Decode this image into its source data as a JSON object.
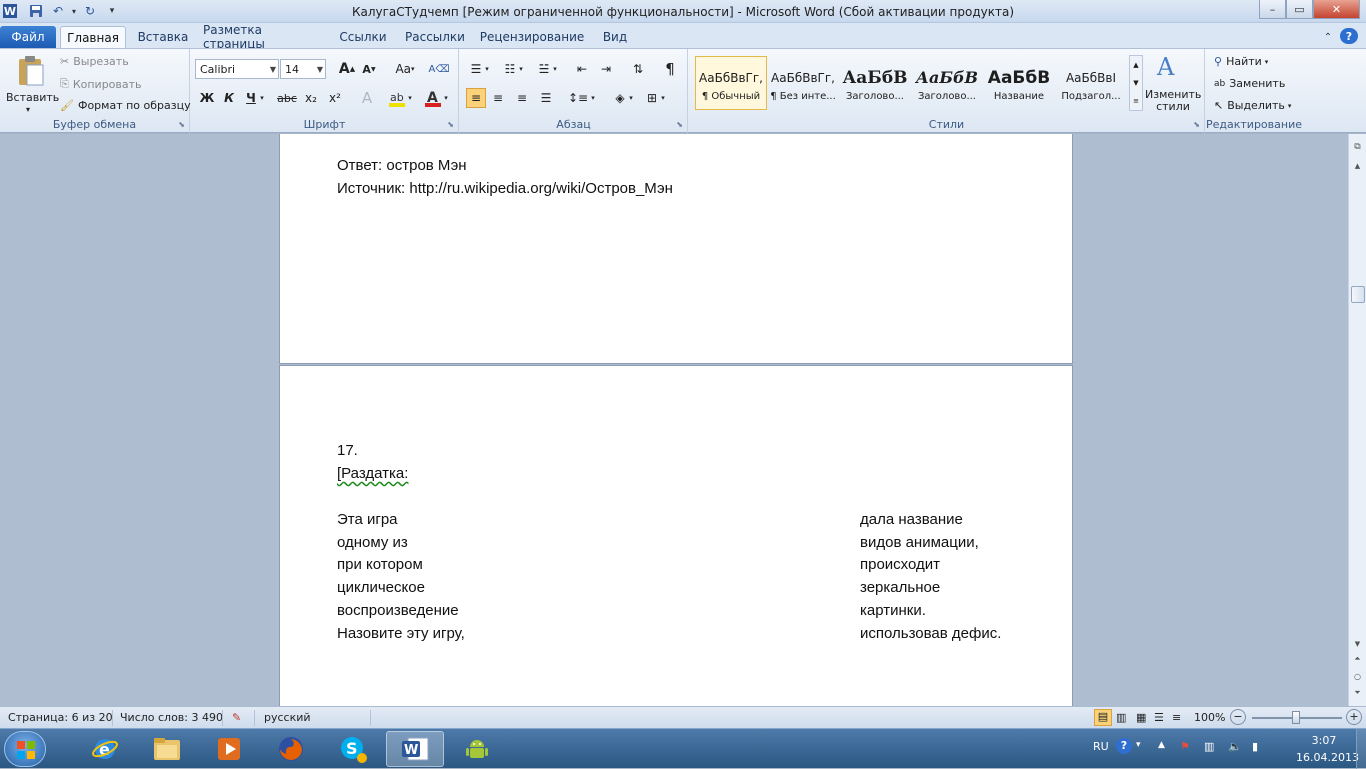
{
  "window": {
    "title": "КалугаСТудчемп [Режим ограниченной функциональности]  -  Microsoft Word (Сбой активации продукта)",
    "app_icon": "W",
    "minimize_glyph": "–",
    "maximize_glyph": "▭",
    "close_glyph": "✕"
  },
  "tabs": {
    "file": "Файл",
    "home": "Главная",
    "insert": "Вставка",
    "layout": "Разметка страницы",
    "references": "Ссылки",
    "mailings": "Рассылки",
    "review": "Рецензирование",
    "view": "Вид"
  },
  "clipboard": {
    "paste": "Вставить",
    "cut": "Вырезать",
    "copy": "Копировать",
    "format_painter": "Формат по образцу",
    "label": "Буфер обмена"
  },
  "font": {
    "name": "Calibri",
    "size": "14",
    "label": "Шрифт",
    "bold": "Ж",
    "italic": "К",
    "underline": "Ч",
    "strike": "abc",
    "subscript": "x₂",
    "superscript": "x²",
    "grow": "A",
    "shrink": "A",
    "change_case": "Aa",
    "font_color": "A",
    "font_color_hex": "#d7211f",
    "highlight_hex": "#f0e000"
  },
  "paragraph": {
    "label": "Абзац",
    "pilcrow": "¶"
  },
  "styles": {
    "label": "Стили",
    "items": [
      {
        "preview": "АаБбВвГг,",
        "name": "¶ Обычный"
      },
      {
        "preview": "АаБбВвГг,",
        "name": "¶ Без инте..."
      },
      {
        "preview": "АаБбВ",
        "name": "Заголово..."
      },
      {
        "preview": "АаБбВ",
        "name": "Заголово..."
      },
      {
        "preview": "АаБбВ",
        "name": "Название"
      },
      {
        "preview": "АаБбВвІ",
        "name": "Подзагол..."
      }
    ],
    "change_styles": "Изменить стили"
  },
  "editing": {
    "label": "Редактирование",
    "find": "Найти",
    "replace": "Заменить",
    "select": "Выделить"
  },
  "document": {
    "page1_lines": [
      "Ответ: остров Мэн",
      "Источник: http://ru.wikipedia.org/wiki/Остров_Мэн"
    ],
    "number": "17.",
    "handout": "[Раздатка:",
    "left_column": [
      "Эта игра",
      "одному из",
      "при котором",
      "циклическое",
      "воспроизведение",
      "Назовите эту игру,"
    ],
    "right_column": [
      "дала название",
      "видов анимации,",
      "происходит",
      "зеркальное",
      "картинки.",
      "использовав дефис."
    ]
  },
  "status": {
    "page": "Страница: 6 из 20",
    "words": "Число слов: 3 490",
    "language": "русский",
    "zoom": "100%"
  },
  "taskbar": {
    "language": "RU",
    "time": "3:07",
    "date": "16.04.2013"
  },
  "colors": {
    "accent": "#2b579a",
    "file_tab": "#2a6ac6",
    "taskbar": "#2f5b88"
  }
}
